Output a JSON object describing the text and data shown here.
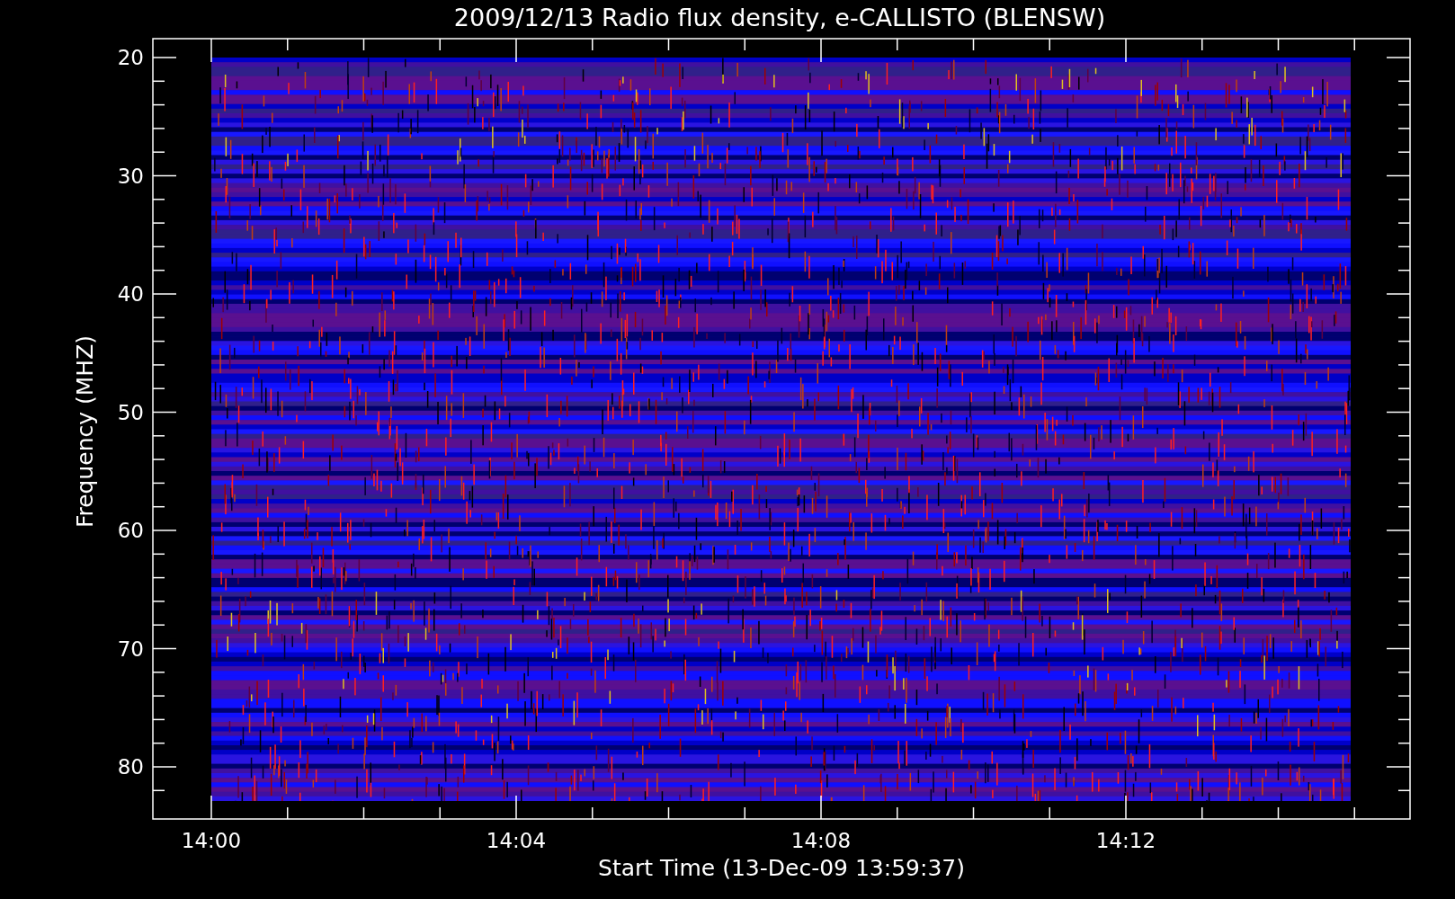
{
  "title": "2009/12/13  Radio flux density, e-CALLISTO (BLENSW)",
  "y_axis": {
    "label": "Frequency (MHZ)",
    "ticks": [
      "20",
      "30",
      "40",
      "50",
      "60",
      "70",
      "80"
    ]
  },
  "x_axis": {
    "label": "Start Time (13-Dec-09 13:59:37)",
    "ticks": [
      "14:00",
      "14:04",
      "14:08",
      "14:12"
    ]
  }
}
